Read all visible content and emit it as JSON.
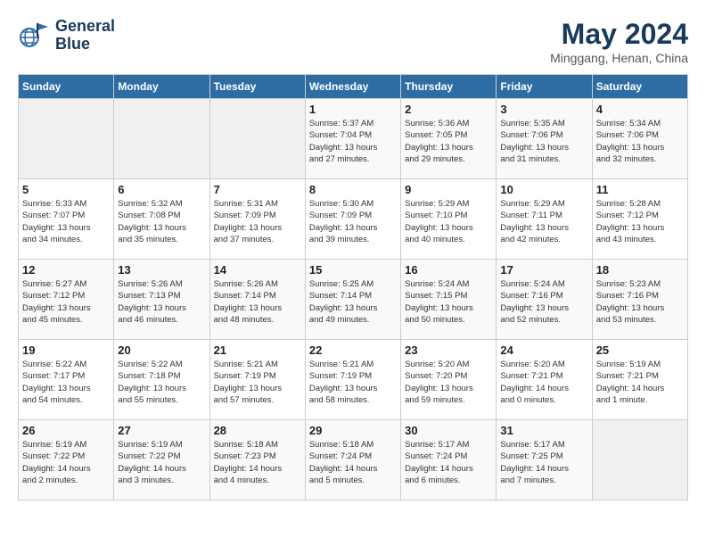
{
  "header": {
    "logo_line1": "General",
    "logo_line2": "Blue",
    "main_title": "May 2024",
    "subtitle": "Minggang, Henan, China"
  },
  "days_of_week": [
    "Sunday",
    "Monday",
    "Tuesday",
    "Wednesday",
    "Thursday",
    "Friday",
    "Saturday"
  ],
  "weeks": [
    [
      {
        "day": "",
        "detail": ""
      },
      {
        "day": "",
        "detail": ""
      },
      {
        "day": "",
        "detail": ""
      },
      {
        "day": "1",
        "detail": "Sunrise: 5:37 AM\nSunset: 7:04 PM\nDaylight: 13 hours\nand 27 minutes."
      },
      {
        "day": "2",
        "detail": "Sunrise: 5:36 AM\nSunset: 7:05 PM\nDaylight: 13 hours\nand 29 minutes."
      },
      {
        "day": "3",
        "detail": "Sunrise: 5:35 AM\nSunset: 7:06 PM\nDaylight: 13 hours\nand 31 minutes."
      },
      {
        "day": "4",
        "detail": "Sunrise: 5:34 AM\nSunset: 7:06 PM\nDaylight: 13 hours\nand 32 minutes."
      }
    ],
    [
      {
        "day": "5",
        "detail": "Sunrise: 5:33 AM\nSunset: 7:07 PM\nDaylight: 13 hours\nand 34 minutes."
      },
      {
        "day": "6",
        "detail": "Sunrise: 5:32 AM\nSunset: 7:08 PM\nDaylight: 13 hours\nand 35 minutes."
      },
      {
        "day": "7",
        "detail": "Sunrise: 5:31 AM\nSunset: 7:09 PM\nDaylight: 13 hours\nand 37 minutes."
      },
      {
        "day": "8",
        "detail": "Sunrise: 5:30 AM\nSunset: 7:09 PM\nDaylight: 13 hours\nand 39 minutes."
      },
      {
        "day": "9",
        "detail": "Sunrise: 5:29 AM\nSunset: 7:10 PM\nDaylight: 13 hours\nand 40 minutes."
      },
      {
        "day": "10",
        "detail": "Sunrise: 5:29 AM\nSunset: 7:11 PM\nDaylight: 13 hours\nand 42 minutes."
      },
      {
        "day": "11",
        "detail": "Sunrise: 5:28 AM\nSunset: 7:12 PM\nDaylight: 13 hours\nand 43 minutes."
      }
    ],
    [
      {
        "day": "12",
        "detail": "Sunrise: 5:27 AM\nSunset: 7:12 PM\nDaylight: 13 hours\nand 45 minutes."
      },
      {
        "day": "13",
        "detail": "Sunrise: 5:26 AM\nSunset: 7:13 PM\nDaylight: 13 hours\nand 46 minutes."
      },
      {
        "day": "14",
        "detail": "Sunrise: 5:26 AM\nSunset: 7:14 PM\nDaylight: 13 hours\nand 48 minutes."
      },
      {
        "day": "15",
        "detail": "Sunrise: 5:25 AM\nSunset: 7:14 PM\nDaylight: 13 hours\nand 49 minutes."
      },
      {
        "day": "16",
        "detail": "Sunrise: 5:24 AM\nSunset: 7:15 PM\nDaylight: 13 hours\nand 50 minutes."
      },
      {
        "day": "17",
        "detail": "Sunrise: 5:24 AM\nSunset: 7:16 PM\nDaylight: 13 hours\nand 52 minutes."
      },
      {
        "day": "18",
        "detail": "Sunrise: 5:23 AM\nSunset: 7:16 PM\nDaylight: 13 hours\nand 53 minutes."
      }
    ],
    [
      {
        "day": "19",
        "detail": "Sunrise: 5:22 AM\nSunset: 7:17 PM\nDaylight: 13 hours\nand 54 minutes."
      },
      {
        "day": "20",
        "detail": "Sunrise: 5:22 AM\nSunset: 7:18 PM\nDaylight: 13 hours\nand 55 minutes."
      },
      {
        "day": "21",
        "detail": "Sunrise: 5:21 AM\nSunset: 7:19 PM\nDaylight: 13 hours\nand 57 minutes."
      },
      {
        "day": "22",
        "detail": "Sunrise: 5:21 AM\nSunset: 7:19 PM\nDaylight: 13 hours\nand 58 minutes."
      },
      {
        "day": "23",
        "detail": "Sunrise: 5:20 AM\nSunset: 7:20 PM\nDaylight: 13 hours\nand 59 minutes."
      },
      {
        "day": "24",
        "detail": "Sunrise: 5:20 AM\nSunset: 7:21 PM\nDaylight: 14 hours\nand 0 minutes."
      },
      {
        "day": "25",
        "detail": "Sunrise: 5:19 AM\nSunset: 7:21 PM\nDaylight: 14 hours\nand 1 minute."
      }
    ],
    [
      {
        "day": "26",
        "detail": "Sunrise: 5:19 AM\nSunset: 7:22 PM\nDaylight: 14 hours\nand 2 minutes."
      },
      {
        "day": "27",
        "detail": "Sunrise: 5:19 AM\nSunset: 7:22 PM\nDaylight: 14 hours\nand 3 minutes."
      },
      {
        "day": "28",
        "detail": "Sunrise: 5:18 AM\nSunset: 7:23 PM\nDaylight: 14 hours\nand 4 minutes."
      },
      {
        "day": "29",
        "detail": "Sunrise: 5:18 AM\nSunset: 7:24 PM\nDaylight: 14 hours\nand 5 minutes."
      },
      {
        "day": "30",
        "detail": "Sunrise: 5:17 AM\nSunset: 7:24 PM\nDaylight: 14 hours\nand 6 minutes."
      },
      {
        "day": "31",
        "detail": "Sunrise: 5:17 AM\nSunset: 7:25 PM\nDaylight: 14 hours\nand 7 minutes."
      },
      {
        "day": "",
        "detail": ""
      }
    ]
  ]
}
